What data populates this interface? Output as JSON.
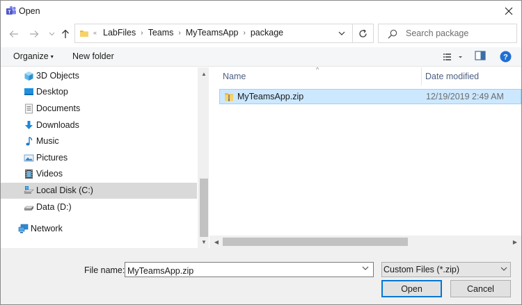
{
  "window": {
    "title": "Open"
  },
  "address": {
    "crumbs": [
      "LabFiles",
      "Teams",
      "MyTeamsApp",
      "package"
    ]
  },
  "search": {
    "placeholder": "Search package"
  },
  "toolbar": {
    "organize_label": "Organize",
    "new_folder_label": "New folder"
  },
  "sidebar": {
    "items": [
      {
        "label": "3D Objects",
        "icon": "3d-objects-icon"
      },
      {
        "label": "Desktop",
        "icon": "desktop-icon"
      },
      {
        "label": "Documents",
        "icon": "documents-icon"
      },
      {
        "label": "Downloads",
        "icon": "downloads-icon"
      },
      {
        "label": "Music",
        "icon": "music-icon"
      },
      {
        "label": "Pictures",
        "icon": "pictures-icon"
      },
      {
        "label": "Videos",
        "icon": "videos-icon"
      },
      {
        "label": "Local Disk (C:)",
        "icon": "local-disk-icon",
        "selected": true
      },
      {
        "label": "Data (D:)",
        "icon": "drive-icon"
      },
      {
        "label": "Network",
        "icon": "network-icon"
      }
    ]
  },
  "filelist": {
    "columns": [
      "Name",
      "Date modified"
    ],
    "rows": [
      {
        "name": "MyTeamsApp.zip",
        "date_modified": "12/19/2019 2:49 AM",
        "selected": true
      }
    ]
  },
  "footer": {
    "filename_label": "File name:",
    "filename_value": "MyTeamsApp.zip",
    "filetype_value": "Custom Files (*.zip)",
    "open_label": "Open",
    "cancel_label": "Cancel"
  },
  "colors": {
    "accent": "#0078d7",
    "selection": "#cce8ff",
    "help": "#1f6fd1"
  }
}
